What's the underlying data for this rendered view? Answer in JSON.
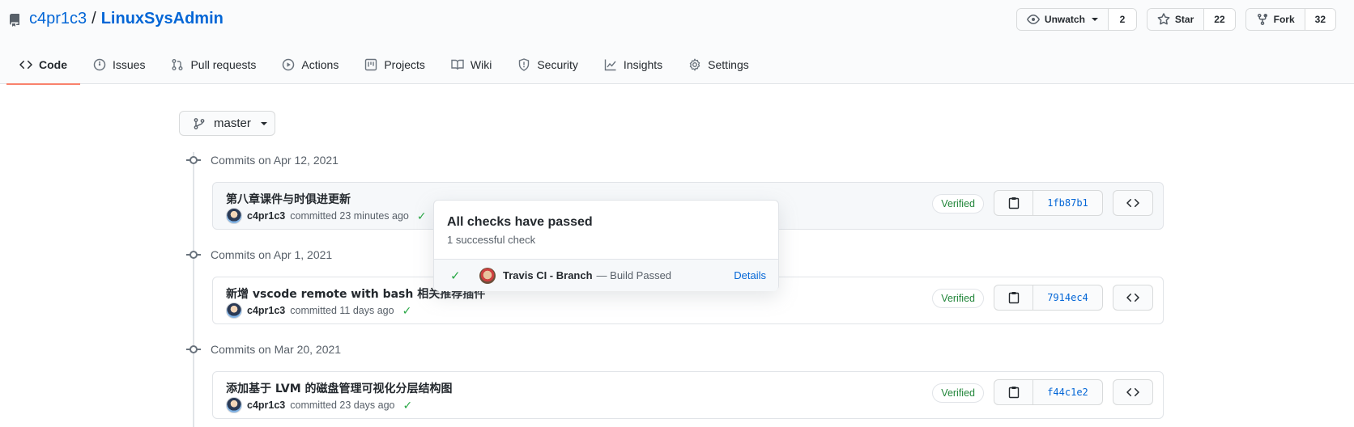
{
  "repo": {
    "owner": "c4pr1c3",
    "separator": "/",
    "name": "LinuxSysAdmin"
  },
  "actions": {
    "watch_label": "Unwatch",
    "watch_count": "2",
    "star_label": "Star",
    "star_count": "22",
    "fork_label": "Fork",
    "fork_count": "32"
  },
  "nav": {
    "code": "Code",
    "issues": "Issues",
    "pulls": "Pull requests",
    "actions": "Actions",
    "projects": "Projects",
    "wiki": "Wiki",
    "security": "Security",
    "insights": "Insights",
    "settings": "Settings"
  },
  "branch": {
    "name": "master"
  },
  "commit_groups": [
    {
      "heading": "Commits on Apr 12, 2021",
      "commit": {
        "title": "第八章课件与时俱进更新",
        "author": "c4pr1c3",
        "time_text": "committed 23 minutes ago",
        "verified": "Verified",
        "sha": "1fb87b1"
      }
    },
    {
      "heading": "Commits on Apr 1, 2021",
      "commit": {
        "title": "新增 vscode remote with bash 相关推荐插件",
        "author": "c4pr1c3",
        "time_text": "committed 11 days ago",
        "verified": "Verified",
        "sha": "7914ec4"
      }
    },
    {
      "heading": "Commits on Mar 20, 2021",
      "commit": {
        "title": "添加基于 LVM 的磁盘管理可视化分层结构图",
        "author": "c4pr1c3",
        "time_text": "committed 23 days ago",
        "verified": "Verified",
        "sha": "f44c1e2"
      }
    }
  ],
  "checks_popover": {
    "title": "All checks have passed",
    "subtitle": "1 successful check",
    "check_name": "Travis CI - Branch",
    "check_status": "— Build Passed",
    "details_link": "Details"
  },
  "colors": {
    "link": "#0366d6",
    "success": "#28a745",
    "nav_underline": "#f9826c"
  }
}
